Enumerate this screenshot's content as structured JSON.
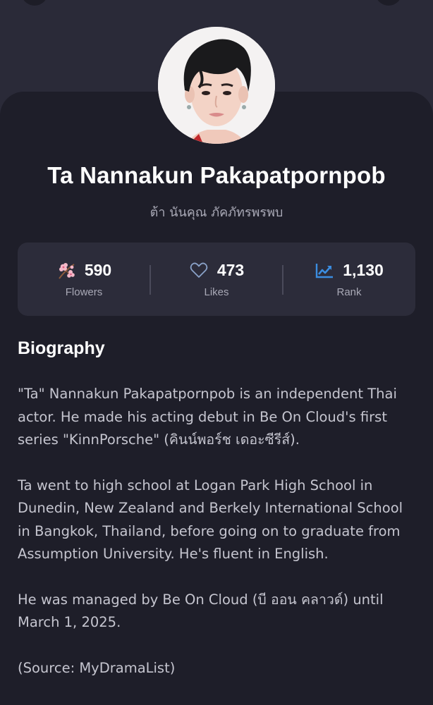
{
  "profile": {
    "name": "Ta Nannakun Pakapatpornpob",
    "native_name": "ต้า นันคุณ ภัคภัทรพรพบ"
  },
  "stats": {
    "flowers": {
      "value": "590",
      "label": "Flowers",
      "icon": "cherry-blossom-icon"
    },
    "likes": {
      "value": "473",
      "label": "Likes",
      "icon": "heart-outline-icon"
    },
    "rank": {
      "value": "1,130",
      "label": "Rank",
      "icon": "trending-chart-icon"
    }
  },
  "biography": {
    "title": "Biography",
    "paragraphs": [
      "\"Ta\" Nannakun Pakapatpornpob is an independent Thai actor. He made his acting debut in Be On Cloud's first series \"KinnPorsche\" (คินน์พอร์ช เดอะซีรีส์).",
      "Ta went to high school at Logan Park High School in Dunedin, New Zealand and Berkely International School in Bangkok, Thailand, before going on to graduate from Assumption University. He's fluent in English.",
      "He was managed by Be On Cloud (บี ออน คลาวด์) until March 1, 2025.",
      "(Source: MyDramaList)"
    ]
  },
  "colors": {
    "background": "#2a2a38",
    "card": "#1e1e29",
    "stats_panel": "#2c2c3a",
    "muted_text": "#a9a9b6",
    "rank_accent": "#3b8de0",
    "heart_accent": "#8aa2c8"
  }
}
